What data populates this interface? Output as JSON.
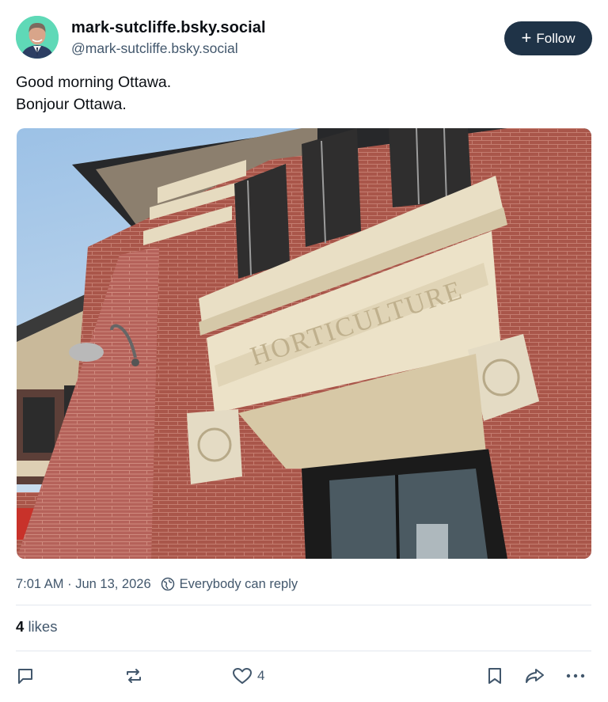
{
  "author": {
    "display_name": "mark-sutcliffe.bsky.social",
    "handle": "@mark-sutcliffe.bsky.social",
    "avatar_icon": "person-avatar",
    "avatar_bg": "#5fd9b7"
  },
  "follow": {
    "label": "Follow",
    "icon": "plus-icon"
  },
  "post": {
    "lines": [
      "Good morning Ottawa.",
      "Bonjour Ottawa."
    ],
    "image_sign": "HORTICULTURE",
    "image_icon": "building-photo"
  },
  "meta": {
    "timestamp": "7:01 AM · Jun 13, 2026",
    "reply_setting": "Everybody can reply"
  },
  "stats": {
    "likes_count": "4",
    "likes_label": "likes"
  },
  "actions": {
    "like_count": "4",
    "icons": [
      "reply-icon",
      "repost-icon",
      "like-icon",
      "bookmark-icon",
      "share-icon",
      "more-icon"
    ]
  },
  "colors": {
    "text": "#0b0f14",
    "muted": "#42576c",
    "follow_bg": "#1f3347",
    "divider": "#e2e7ee"
  }
}
